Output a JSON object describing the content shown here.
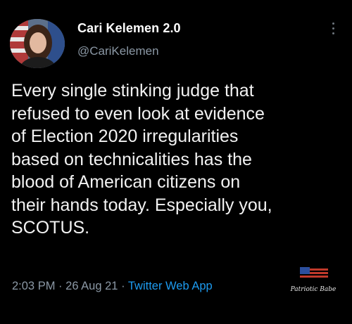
{
  "tweet": {
    "display_name": "Cari Kelemen 2.0",
    "handle": "@CariKelemen",
    "text_lines": [
      "Every single stinking judge that",
      "refused to even look at evidence",
      "of Election 2020 irregularities",
      "based on technicalities has the",
      "blood of American citizens on",
      "their hands today. Especially you,",
      "SCOTUS."
    ],
    "time": "2:03 PM",
    "date": "26 Aug 21",
    "separator": "·",
    "source": "Twitter Web App"
  },
  "watermark": {
    "text": "Patriotic Babe"
  },
  "icons": {
    "more": "more-options-icon",
    "avatar": "avatar"
  },
  "colors": {
    "background": "#000000",
    "text": "#f2f2f2",
    "secondary": "#8b98a5",
    "link": "#1d9bf0"
  }
}
